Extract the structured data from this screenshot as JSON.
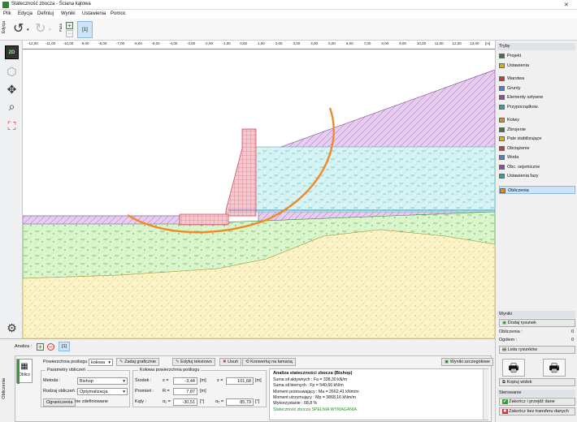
{
  "window": {
    "title": "Stateczność zbocza - Ściana kątowa"
  },
  "menu": [
    "Plik",
    "Edycja",
    "Definiuj",
    "Wyniki",
    "Ustawienia",
    "Pomoc"
  ],
  "toolbar": {
    "side_label": "Edycja",
    "faza_label": "Faza",
    "stage": "[1]"
  },
  "ruler": [
    "-12,00",
    "-11,00",
    "-10,00",
    "-9,00",
    "-8,00",
    "-7,00",
    "-6,00",
    "-5,00",
    "-4,00",
    "-3,00",
    "-2,00",
    "-1,00",
    "0,00",
    "1,00",
    "2,00",
    "3,00",
    "4,00",
    "5,00",
    "6,00",
    "7,00",
    "8,00",
    "9,00",
    "10,00",
    "11,00",
    "12,00",
    "13,00"
  ],
  "ruler_unit": "[m]",
  "left_tools": {
    "mode_2d": "2D"
  },
  "right_panel": {
    "header": "Tryby",
    "groups": [
      [
        "Projekt",
        "Ustawienia"
      ],
      [
        "Warstwa",
        "Grunty",
        "Elementy sztywne",
        "Przyporządkow."
      ],
      [
        "Kotwy",
        "Zbrojenie",
        "Pale stabilizujące",
        "Obciążenie",
        "Woda",
        "Obc. sejsmiczne",
        "Ustawienia fazy"
      ],
      [
        "Obliczenia"
      ]
    ],
    "active": "Obliczenia",
    "wyniki": {
      "header": "Wyniki",
      "add_picture": "Dodaj rysunek",
      "rows": [
        {
          "label": "Obliczenia :",
          "value": "0"
        },
        {
          "label": "Ogółem :",
          "value": "0"
        }
      ],
      "list_pictures": "Lista rysunków",
      "copy_view": "Kopiuj widok"
    },
    "sterowanie": {
      "header": "Sterowanie",
      "finish": "Zakończ i przejdź dane",
      "finish_no_transfer": "Zakończ bez transferu danych"
    }
  },
  "bottom": {
    "analysis_label": "Analiza :",
    "analysis_tab": "[1]",
    "side_tab": "Obliczenia",
    "calc_button": "Oblicz",
    "surface_label": "Powierzchnia poślizgu :",
    "surface_value": "kołowa",
    "edit_graphic": "Zadaj graficznie",
    "edit_text": "Edytuj tekstowo",
    "delete": "Usuń",
    "convert": "Konwertuj na łamaną",
    "detailed_results": "Wyniki szczegółowe",
    "params_title": "Parametry obliczeń",
    "method_label": "Metoda :",
    "method_value": "Bishop",
    "calc_type_label": "Rodzaj obliczeń :",
    "calc_type_value": "Optymalizacja",
    "restrictions_button": "Ograniczenia",
    "restrictions_value": "nie zdefiniowane",
    "circle_title": "Kołowa powierzchnia poślizgu",
    "center_label": "Środek :",
    "x_label": "x =",
    "x_value": "-3,44",
    "z_label": "z =",
    "z_value": "101,68",
    "unit_m": "[m]",
    "radius_label": "Promień :",
    "r_label": "R =",
    "r_value": "7,87",
    "angles_label": "Kąty :",
    "a1_label": "α₁ =",
    "a1_value": "-30,51",
    "a2_label": "α₂ =",
    "a2_value": "85,79",
    "unit_deg": "[°]",
    "results": {
      "title": "Analiza stateczności zbocza (Bishop)",
      "lines": [
        "Suma sił aktywnych :   Fa =   338,30 kN/m",
        "Suma sił biernych :    Fp =   540,66 kN/m",
        "Moment przesuwający :  Ma =  2662,41 kNm/m",
        "Moment utrzymujący :   Mp =  3868,16 kNm/m",
        "Wykorzystanie : 68,8 %"
      ],
      "verdict": "Stateczność zbocza SPEŁNIA WYMAGANIA"
    }
  },
  "colors": {
    "layer_purple": "#e6cfee",
    "layer_water": "#d8f3f3",
    "layer_green": "#dbf5cc",
    "layer_yellow": "#fbf3c9",
    "wall": "#f5c7cf",
    "slip_surface": "#f08a24",
    "active": "#cde3f7"
  }
}
